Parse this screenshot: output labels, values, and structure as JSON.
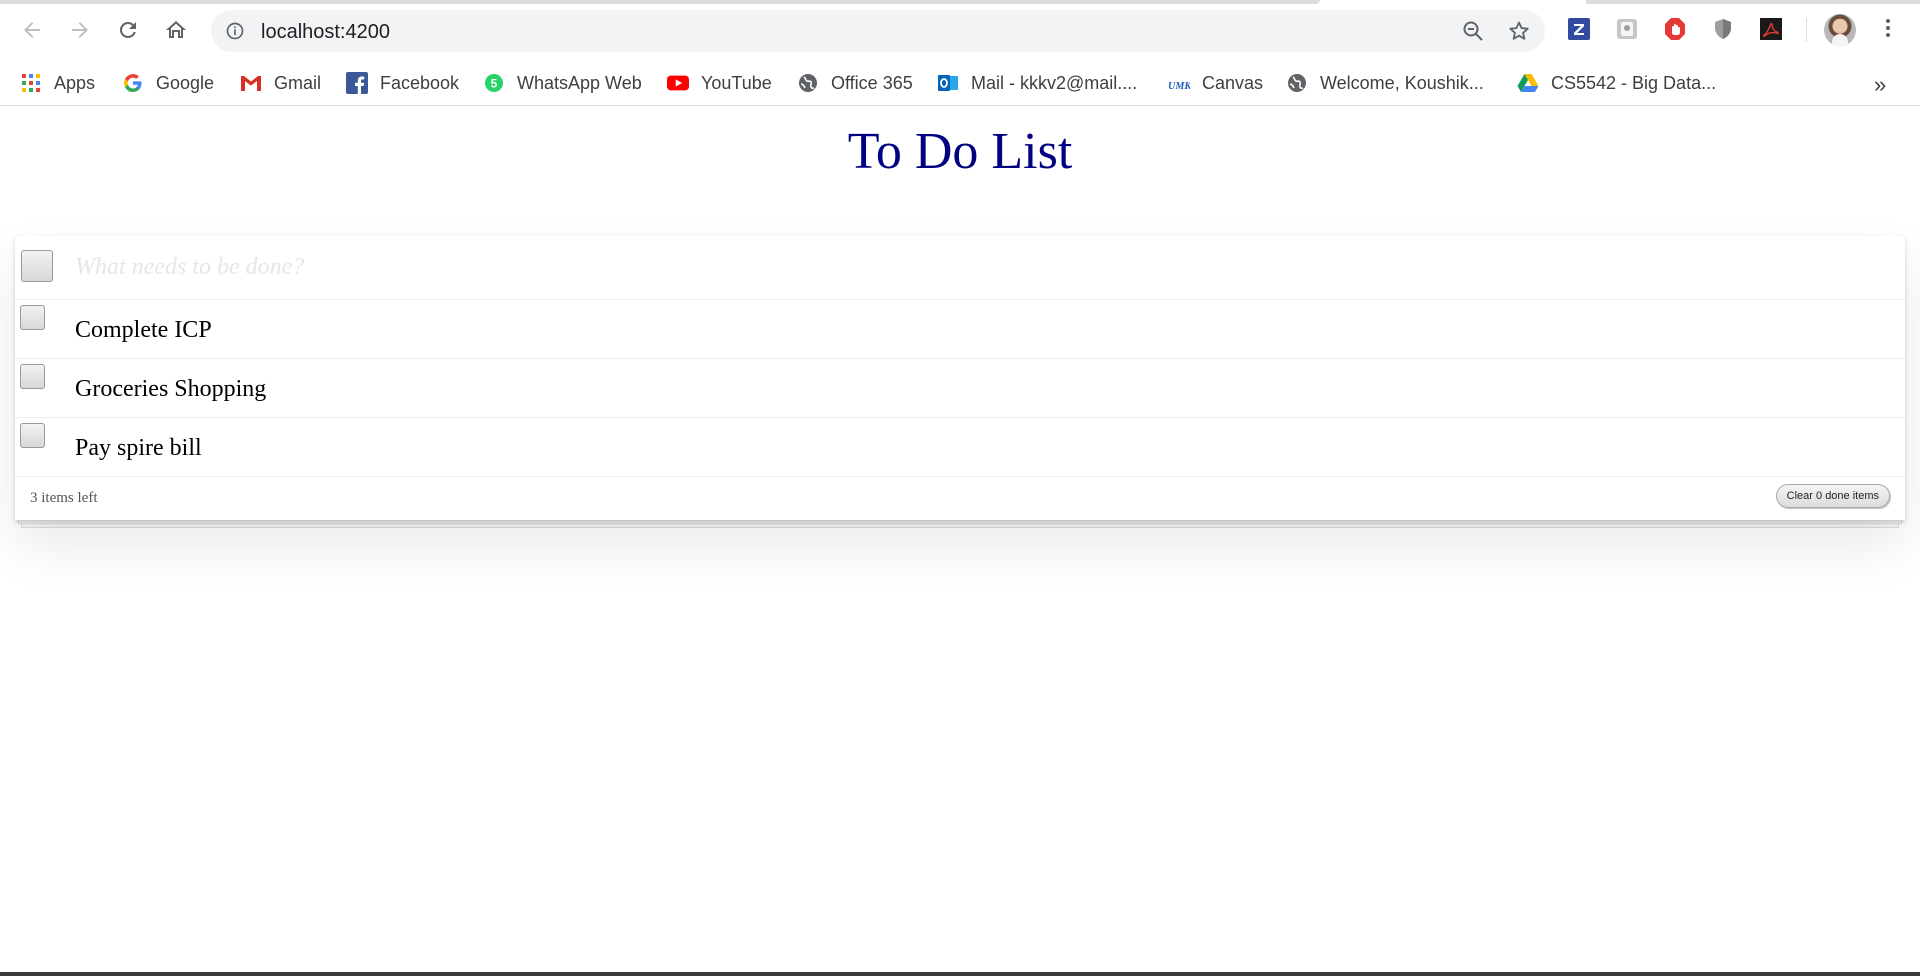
{
  "browser": {
    "url": "localhost:4200",
    "bookmarks": [
      {
        "label": "Apps",
        "icon": "apps-grid-icon"
      },
      {
        "label": "Google",
        "icon": "google-icon"
      },
      {
        "label": "Gmail",
        "icon": "gmail-icon"
      },
      {
        "label": "Facebook",
        "icon": "facebook-icon"
      },
      {
        "label": "WhatsApp Web",
        "icon": "whatsapp-icon"
      },
      {
        "label": "YouTube",
        "icon": "youtube-icon"
      },
      {
        "label": "Office 365",
        "icon": "globe-icon"
      },
      {
        "label": "Mail - kkkv2@mail....",
        "icon": "outlook-icon"
      },
      {
        "label": "Canvas",
        "icon": "umkc-icon"
      },
      {
        "label": "Welcome, Koushik...",
        "icon": "globe-icon"
      },
      {
        "label": "CS5542 - Big Data...",
        "icon": "google-drive-icon"
      }
    ],
    "overflow": "»",
    "extensions": [
      "zotero-icon",
      "extension-icon",
      "adblock-icon",
      "shield-icon",
      "acrobat-icon"
    ]
  },
  "app": {
    "title": "To Do List",
    "new_todo_placeholder": "What needs to be done?",
    "todos": [
      {
        "title": "Complete ICP",
        "done": false
      },
      {
        "title": "Groceries Shopping",
        "done": false
      },
      {
        "title": "Pay spire bill",
        "done": false
      }
    ],
    "footer": {
      "items_left": "3 items left",
      "clear_label": "Clear 0 done items"
    }
  },
  "colors": {
    "title": "#000080",
    "omnibox_bg": "#f1f3f4"
  }
}
